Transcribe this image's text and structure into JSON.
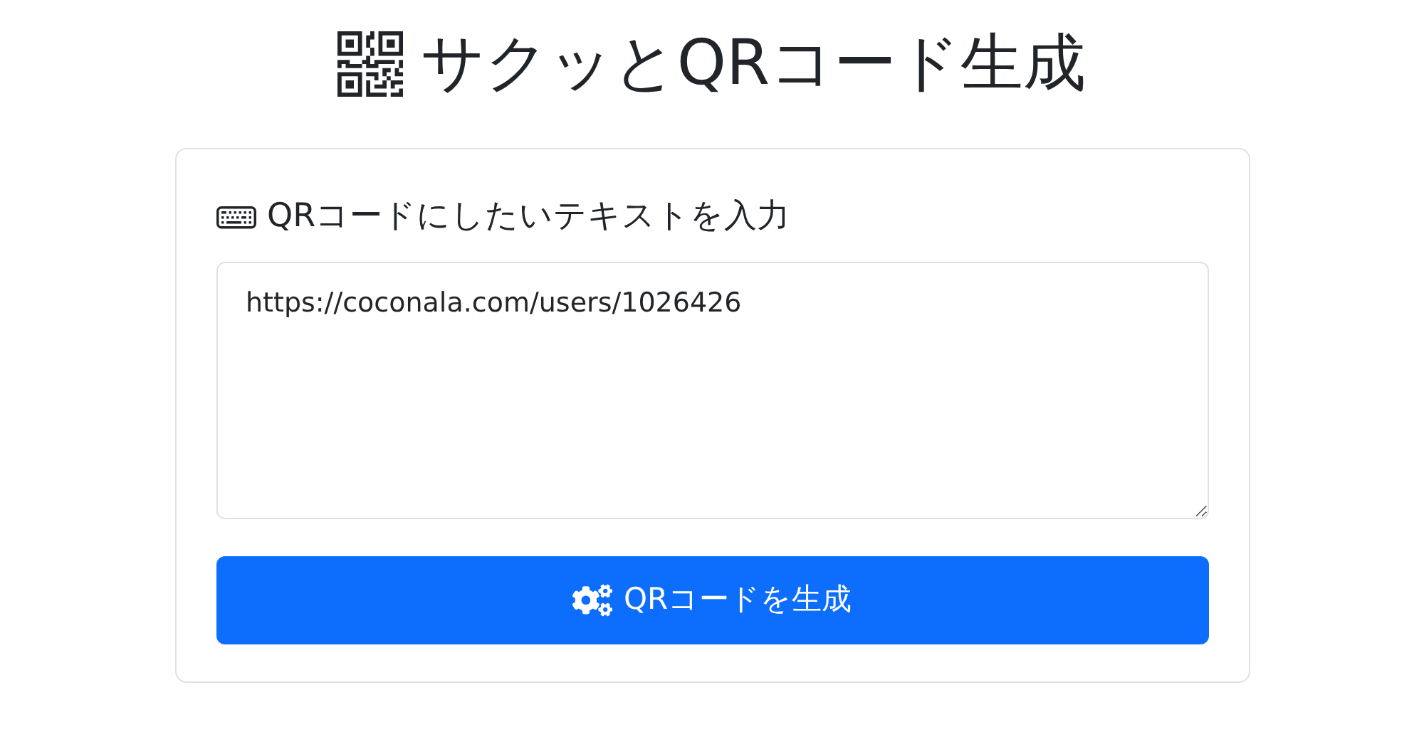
{
  "title": "サクッとQRコード生成",
  "form": {
    "label": "QRコードにしたいテキストを入力",
    "textarea": {
      "value": "https://coconala.com/users/1026426"
    },
    "button": "QRコードを生成"
  }
}
